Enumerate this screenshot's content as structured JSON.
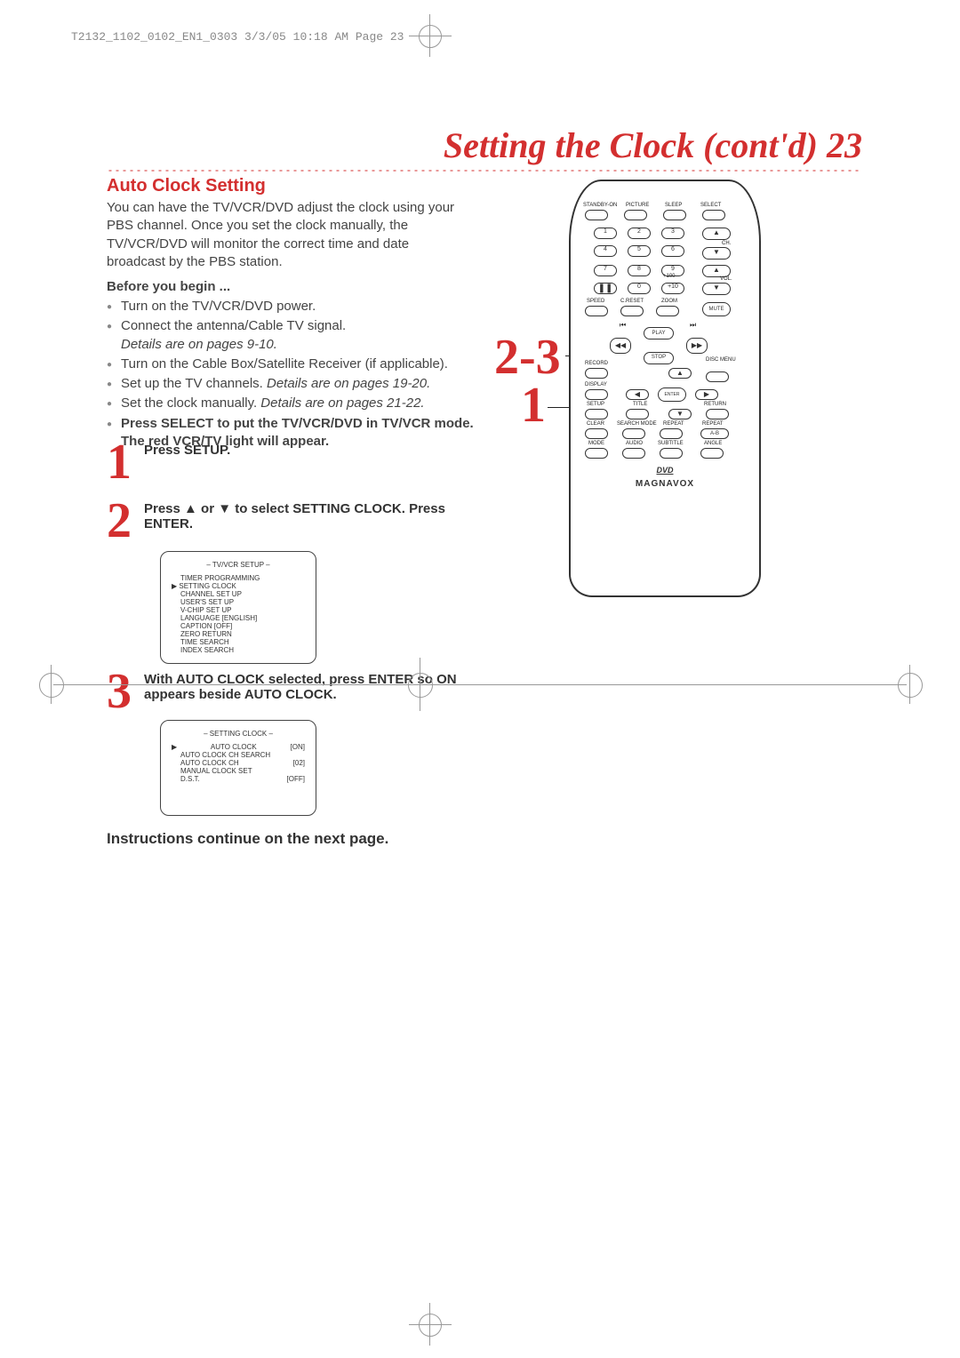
{
  "print_header": "T2132_1102_0102_EN1_0303  3/3/05  10:18 AM  Page 23",
  "page_title": "Setting the Clock (cont'd)  23",
  "section_title": "Auto Clock Setting",
  "intro": "You can have the TV/VCR/DVD adjust the clock using your PBS channel. Once you set the clock manually, the TV/VCR/DVD will monitor the correct time and date broadcast by the PBS station.",
  "before": {
    "title": "Before you begin ...",
    "items": [
      {
        "text": "Turn on the TV/VCR/DVD power."
      },
      {
        "text": "Connect the antenna/Cable TV signal.",
        "detail": "Details are on pages 9-10."
      },
      {
        "text": "Turn on the Cable Box/Satellite Receiver (if applicable)."
      },
      {
        "text": "Set up the TV channels.",
        "detail_inline": "Details are on pages 19-20."
      },
      {
        "text": "Set the clock manually.",
        "detail_inline": "Details are on pages 21-22."
      },
      {
        "bold": "Press SELECT to put the TV/VCR/DVD in TV/VCR mode. The red VCR/TV light will appear."
      }
    ]
  },
  "steps": {
    "s1": {
      "num": "1",
      "text": "Press SETUP."
    },
    "s2": {
      "num": "2",
      "text": "Press ▲ or ▼ to select SETTING CLOCK. Press ENTER."
    },
    "s3": {
      "num": "3",
      "text": "With AUTO CLOCK selected, press ENTER so ON appears beside AUTO CLOCK."
    }
  },
  "osd1": {
    "title": "– TV/VCR SETUP –",
    "lines": [
      "TIMER PROGRAMMING",
      "SETTING CLOCK",
      "CHANNEL SET UP",
      "USER'S SET UP",
      "V-CHIP SET UP",
      "LANGUAGE  [ENGLISH]",
      "CAPTION  [OFF]",
      "ZERO RETURN",
      "TIME SEARCH",
      "INDEX SEARCH"
    ],
    "pointer_index": 1
  },
  "osd2": {
    "title": "– SETTING CLOCK –",
    "lines": [
      {
        "l": "AUTO CLOCK",
        "r": "[ON]"
      },
      {
        "l": "AUTO CLOCK CH SEARCH",
        "r": ""
      },
      {
        "l": "AUTO CLOCK CH",
        "r": "[02]"
      },
      {
        "l": "MANUAL CLOCK SET",
        "r": ""
      },
      {
        "l": "D.S.T.",
        "r": "[OFF]"
      }
    ],
    "pointer_index": 0
  },
  "continue": "Instructions continue on the next page.",
  "remote": {
    "big_step_a": "2-3",
    "big_step_b": "1",
    "row_top": [
      "STANDBY-ON",
      "PICTURE",
      "SLEEP",
      "SELECT"
    ],
    "numpad": [
      "1",
      "2",
      "3",
      "4",
      "5",
      "6",
      "7",
      "8",
      "9",
      "0",
      "+10"
    ],
    "plus100": "+100",
    "ch": "CH.",
    "vol": "VOL.",
    "row_func": [
      "SPEED",
      "C.RESET",
      "ZOOM",
      "MUTE"
    ],
    "transport": {
      "play": "PLAY",
      "stop": "STOP"
    },
    "labels": [
      "RECORD",
      "DISC MENU",
      "DISPLAY",
      "ENTER",
      "SETUP",
      "TITLE",
      "RETURN",
      "CLEAR",
      "SEARCH MODE",
      "REPEAT",
      "REPEAT A-B",
      "MODE",
      "AUDIO",
      "SUBTITLE",
      "ANGLE"
    ],
    "dvd": "DVD",
    "brand": "MAGNAVOX"
  }
}
